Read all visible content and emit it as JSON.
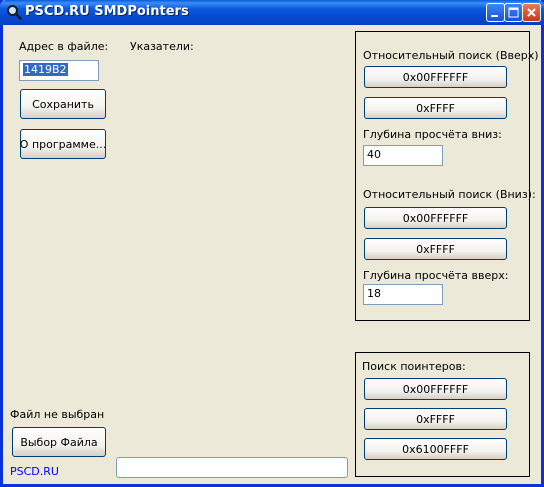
{
  "window": {
    "title": "PSCD.RU SMDPointers"
  },
  "left": {
    "address_label": "Адрес в файле:",
    "address_value": "1419B2",
    "save_button": "Сохранить",
    "about_button": "О программе...",
    "pointers_label": "Указатели:",
    "file_status": "Файл не выбран",
    "choose_file_button": "Выбор Файла",
    "site_link": "PSCD.RU"
  },
  "relative_search": {
    "up_label": "Относительный поиск (Вверх)",
    "up_buttons": [
      "0x00FFFFFF",
      "0xFFFF"
    ],
    "depth_down_label": "Глубина просчёта вниз:",
    "depth_down_value": "40",
    "down_label": "Относительный поиск (Вниз):",
    "down_buttons": [
      "0x00FFFFFF",
      "0xFFFF"
    ],
    "depth_up_label": "Глубина просчёта вверх:",
    "depth_up_value": "18"
  },
  "pointer_search": {
    "label": "Поиск поинтеров:",
    "buttons": [
      "0x00FFFFFF",
      "0xFFFF",
      "0x6100FFFF"
    ]
  },
  "progress": {
    "value": 0
  }
}
